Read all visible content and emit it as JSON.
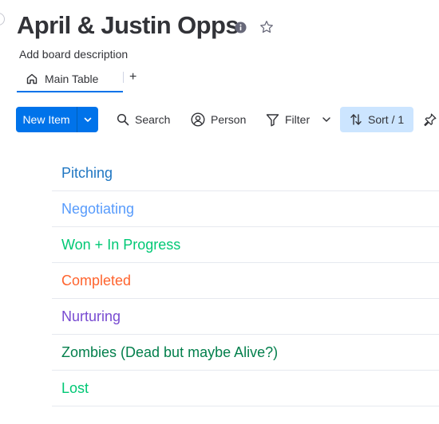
{
  "board": {
    "title": "April & Justin Opps",
    "description": "Add board description"
  },
  "tabs": {
    "main_label": "Main Table",
    "add_label": "+"
  },
  "toolbar": {
    "new_item_label": "New Item",
    "search_label": "Search",
    "person_label": "Person",
    "filter_label": "Filter",
    "sort_label": "Sort / 1"
  },
  "colors": {
    "accent": "#0073ea",
    "sort_active_bg": "#cce5ff"
  },
  "groups": [
    {
      "name": "Pitching",
      "color": "#1f76c2"
    },
    {
      "name": "Negotiating",
      "color": "#579bfc"
    },
    {
      "name": "Won + In Progress",
      "color": "#00c875"
    },
    {
      "name": "Completed",
      "color": "#ff642e"
    },
    {
      "name": "Nurturing",
      "color": "#784bd1"
    },
    {
      "name": "Zombies (Dead but maybe Alive?)",
      "color": "#037f4c"
    },
    {
      "name": "Lost",
      "color": "#00c875"
    }
  ],
  "icons": [
    "info-icon",
    "star-icon",
    "home-icon",
    "chevron-down-icon",
    "search-icon",
    "person-icon",
    "filter-icon",
    "sort-icon",
    "pin-icon"
  ]
}
